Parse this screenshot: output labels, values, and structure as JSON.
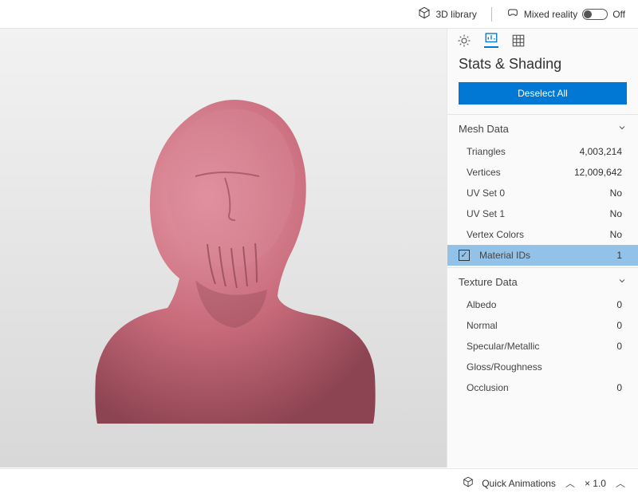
{
  "topbar": {
    "library_label": "3D library",
    "mixed_reality_label": "Mixed reality",
    "mixed_reality_state": "Off"
  },
  "sidebar": {
    "panel_title": "Stats & Shading",
    "deselect_label": "Deselect All",
    "sections": {
      "mesh": {
        "title": "Mesh Data",
        "rows": [
          {
            "label": "Triangles",
            "value": "4,003,214"
          },
          {
            "label": "Vertices",
            "value": "12,009,642"
          },
          {
            "label": "UV Set 0",
            "value": "No"
          },
          {
            "label": "UV Set 1",
            "value": "No"
          },
          {
            "label": "Vertex Colors",
            "value": "No"
          },
          {
            "label": "Material IDs",
            "value": "1",
            "selected": true
          }
        ]
      },
      "texture": {
        "title": "Texture Data",
        "rows": [
          {
            "label": "Albedo",
            "value": "0"
          },
          {
            "label": "Normal",
            "value": "0"
          },
          {
            "label": "Specular/Metallic",
            "value": "0"
          },
          {
            "label": "Gloss/Roughness",
            "value": ""
          },
          {
            "label": "Occlusion",
            "value": "0"
          }
        ]
      }
    }
  },
  "bottombar": {
    "quick_anim_label": "Quick Animations",
    "speed_label": "× 1.0"
  },
  "colors": {
    "accent": "#0078d4",
    "selection": "#93c2e8",
    "model": "#c76a7a"
  }
}
